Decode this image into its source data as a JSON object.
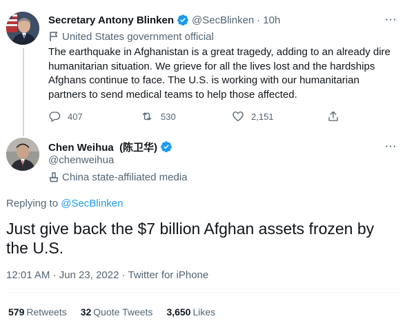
{
  "tweet_parent": {
    "display_name": "Secretary Antony Blinken",
    "handle": "@SecBlinken",
    "separator": "·",
    "time": "10h",
    "label": "United States government official",
    "text": "The earthquake in Afghanistan is a great tragedy, adding to an already dire humanitarian situation. We grieve for all the lives lost and the hardships Afghans continue to face. The U.S. is working with our humanitarian partners to send medical teams to help those affected.",
    "replies": "407",
    "retweets": "530",
    "likes": "2,151",
    "more_label": "···"
  },
  "tweet_main": {
    "display_name": "Chen Weihua  (陈卫华)",
    "handle": "@chenweihua",
    "label": "China state-affiliated media",
    "replying_prefix": "Replying to ",
    "replying_to": "@SecBlinken",
    "text": "Just give back the $7 billion Afghan assets frozen by the U.S.",
    "timestamp": "12:01 AM · Jun 23, 2022 · Twitter for iPhone",
    "more_label": "···",
    "stats": {
      "retweets_count": "579",
      "retweets_label": "Retweets",
      "quote_count": "32",
      "quote_label": "Quote Tweets",
      "likes_count": "3,650",
      "likes_label": "Likes"
    }
  },
  "colors": {
    "text_primary": "#0f1419",
    "text_secondary": "#536471",
    "accent": "#1d9bf0",
    "divider": "#eff3f4",
    "thread_line": "#cfd9de"
  },
  "icons": {
    "verified": "verified-badge-icon",
    "gov_label": "flag-icon",
    "media_label": "podium-icon",
    "reply": "reply-icon",
    "retweet": "retweet-icon",
    "like": "heart-icon",
    "share": "share-icon",
    "more": "more-icon"
  }
}
